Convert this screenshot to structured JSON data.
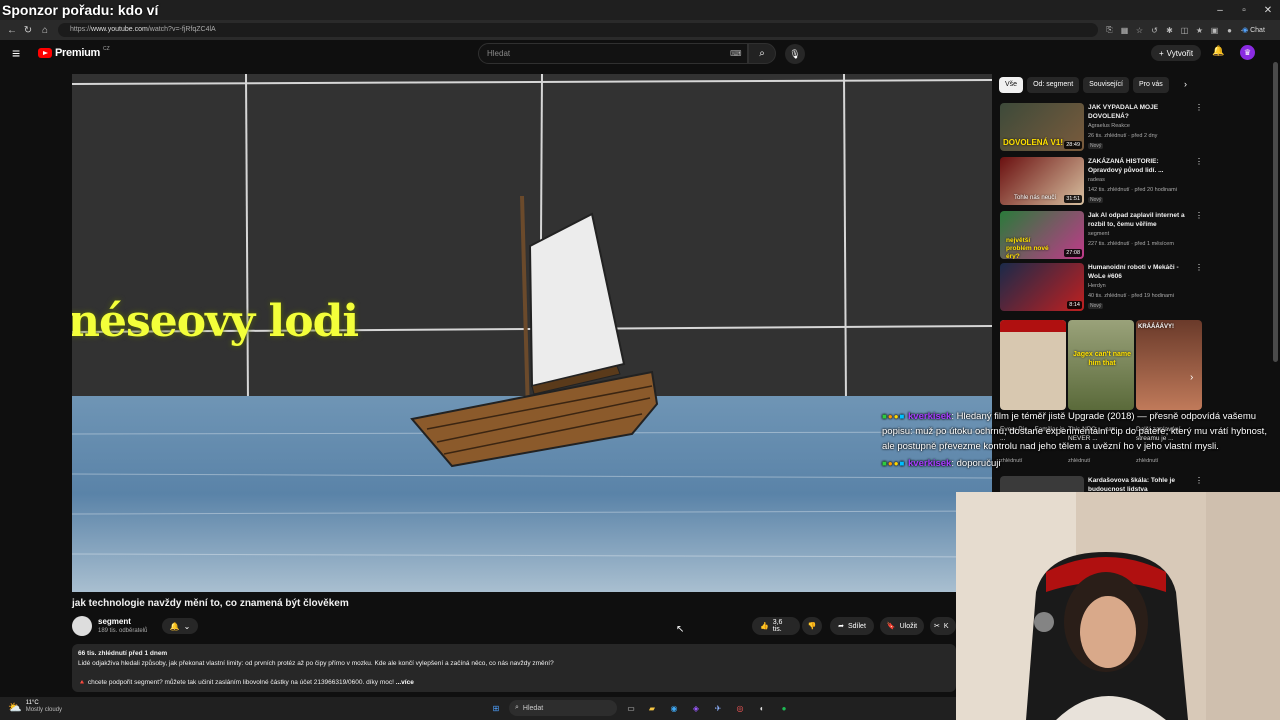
{
  "stream_overlay": {
    "title": "Sponzor pořadu: kdo ví"
  },
  "browser": {
    "url_prefix": "https://",
    "url_host": "www.youtube.com",
    "url_path": "/watch?v=-fjRfqZC4lA",
    "chat_label": "Chat",
    "window_controls": [
      "–",
      "▫",
      "✕"
    ]
  },
  "header": {
    "logo_text": "Premium",
    "logo_badge": "CZ",
    "search_placeholder": "Hledat",
    "create_label": "Vytvořit"
  },
  "video": {
    "overlay_text": "néseovy lodi",
    "title": "jak technologie navždy mění to, co znamená být člověkem",
    "channel": "segment",
    "subscribers": "189 tis. odběratelů",
    "likes": "3,6 tis.",
    "share_label": "Sdílet",
    "save_label": "Uložit",
    "clip_label": "K",
    "description": {
      "stats": "66 tis. zhlédnutí  před 1 dnem",
      "text": "Lidé odjakživa hledali způsoby, jak překonat vlastní limity: od prvních protéz až po čipy přímo v mozku. Kde ale končí vylepšení a začíná něco, co nás navždy změní?",
      "support": "🔺 chcete podpořit segment? můžete tak učinit zasláním libovolné částky na účet 213966319/0600. díky moc!",
      "more": "...více"
    }
  },
  "chips": [
    "Vše",
    "Od: segment",
    "Související",
    "Pro vás"
  ],
  "recommendations": [
    {
      "title": "JAK VYPADALA MOJE DOVOLENÁ?",
      "channel": "Agraelus Reakce",
      "views": "26 tis. zhlédnutí · před 2 dny",
      "badge": "Nový",
      "duration": "28:49",
      "thumb_text": "DOVOLENÁ V1!"
    },
    {
      "title": "ZAKÁZANÁ HISTORIE: Opravdový původ lidí. ...",
      "channel": "radeas",
      "views": "142 tis. zhlédnutí · před 20 hodinami",
      "badge": "Nový",
      "duration": "31:51",
      "thumb_text": "Tohle nás neučí"
    },
    {
      "title": "Jak AI odpad zaplavil internet a rozbil to, čemu věříme",
      "channel": "segment",
      "views": "227 tis. zhlédnutí · před 1 měsícem",
      "badge": "",
      "duration": "27:08",
      "thumb_text": "největší problém nové éry?"
    },
    {
      "title": "Humanoidní roboti v Mekáči - WoLe #606",
      "channel": "Herdyn",
      "views": "40 tis. zhlédnutí · před 19 hodinami",
      "badge": "Nový",
      "duration": "8:14",
      "thumb_text": ""
    }
  ],
  "shorts": [
    {
      "title": "Every Pic... Familiar in ...",
      "views": "zhlédnutí"
    },
    {
      "title": "This NPC ... can NEVER ...",
      "views": "zhlédnutí"
    },
    {
      "title": "Další zaplavání streamu je ...",
      "views": "zhlédnutí"
    }
  ],
  "short_texts": [
    "Jagex can't name him that",
    "KRÁÁÁÁVY!"
  ],
  "last_rec": {
    "title": "Kardašovova škála: Tohle je budoucnost lidstva"
  },
  "chat": [
    {
      "user": "kverkisek",
      "text": ": Hledaný film je téměř jistě Upgrade (2018) — přesně odpovídá vašemu popisu: muž po útoku ochrnu, dostane experimentální čip do páteře, který mu vrátí hybnost, ale postupně převezme kontrolu nad jeho tělem a uvězní ho v jeho vlastní mysli."
    },
    {
      "user": "kverkisek",
      "text": ": doporučuji"
    }
  ],
  "taskbar": {
    "temp": "11°C",
    "weather": "Mostly cloudy",
    "search_placeholder": "Hledat"
  },
  "colors": {
    "accent_red": "#ff0000",
    "chat_user": "#a63cff",
    "bg": "#0f0f0f"
  }
}
